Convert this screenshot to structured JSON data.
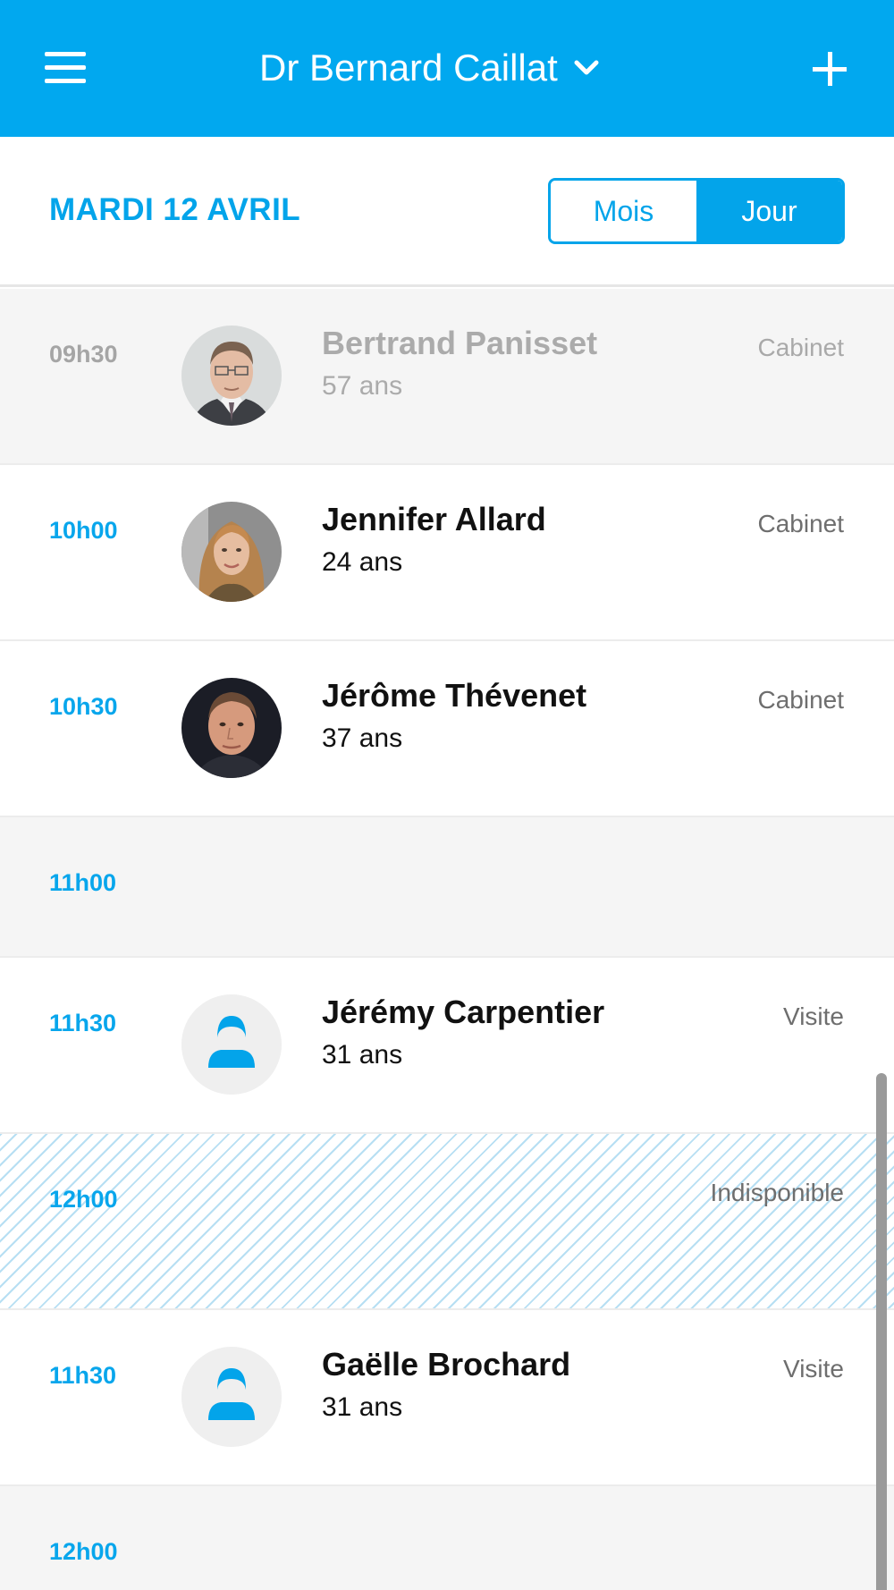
{
  "header": {
    "doctor_name": "Dr Bernard Caillat",
    "menu_icon": "hamburger-menu-icon",
    "dropdown_icon": "chevron-down-icon",
    "add_icon": "plus-icon",
    "background_color": "#01a8ef"
  },
  "date_bar": {
    "date": "MARDI 12 AVRIL",
    "view_toggle": {
      "month_label": "Mois",
      "day_label": "Jour",
      "selected": "Jour"
    }
  },
  "appointments": [
    {
      "time": "09h30",
      "name": "Bertrand Panisset",
      "age": "57 ans",
      "location": "Cabinet",
      "state": "past",
      "avatar": "photo-man-glasses"
    },
    {
      "time": "10h00",
      "name": "Jennifer Allard",
      "age": "24 ans",
      "location": "Cabinet",
      "state": "upcoming",
      "avatar": "photo-woman"
    },
    {
      "time": "10h30",
      "name": "Jérôme Thévenet",
      "age": "37 ans",
      "location": "Cabinet",
      "state": "upcoming",
      "avatar": "photo-man"
    },
    {
      "time": "11h00",
      "state": "empty"
    },
    {
      "time": "11h30",
      "name": "Jérémy Carpentier",
      "age": "31 ans",
      "location": "Visite",
      "state": "upcoming",
      "avatar": "default-user-icon"
    },
    {
      "time": "12h00",
      "location": "Indisponible",
      "state": "unavailable"
    },
    {
      "time": "11h30",
      "name": "Gaëlle Brochard",
      "age": "31 ans",
      "location": "Visite",
      "state": "upcoming",
      "avatar": "default-user-icon"
    },
    {
      "time": "12h00",
      "state": "empty"
    }
  ],
  "colors": {
    "accent": "#03a4ea",
    "past_row_bg": "#f5f5f5",
    "stripe": "#b7dff3"
  }
}
